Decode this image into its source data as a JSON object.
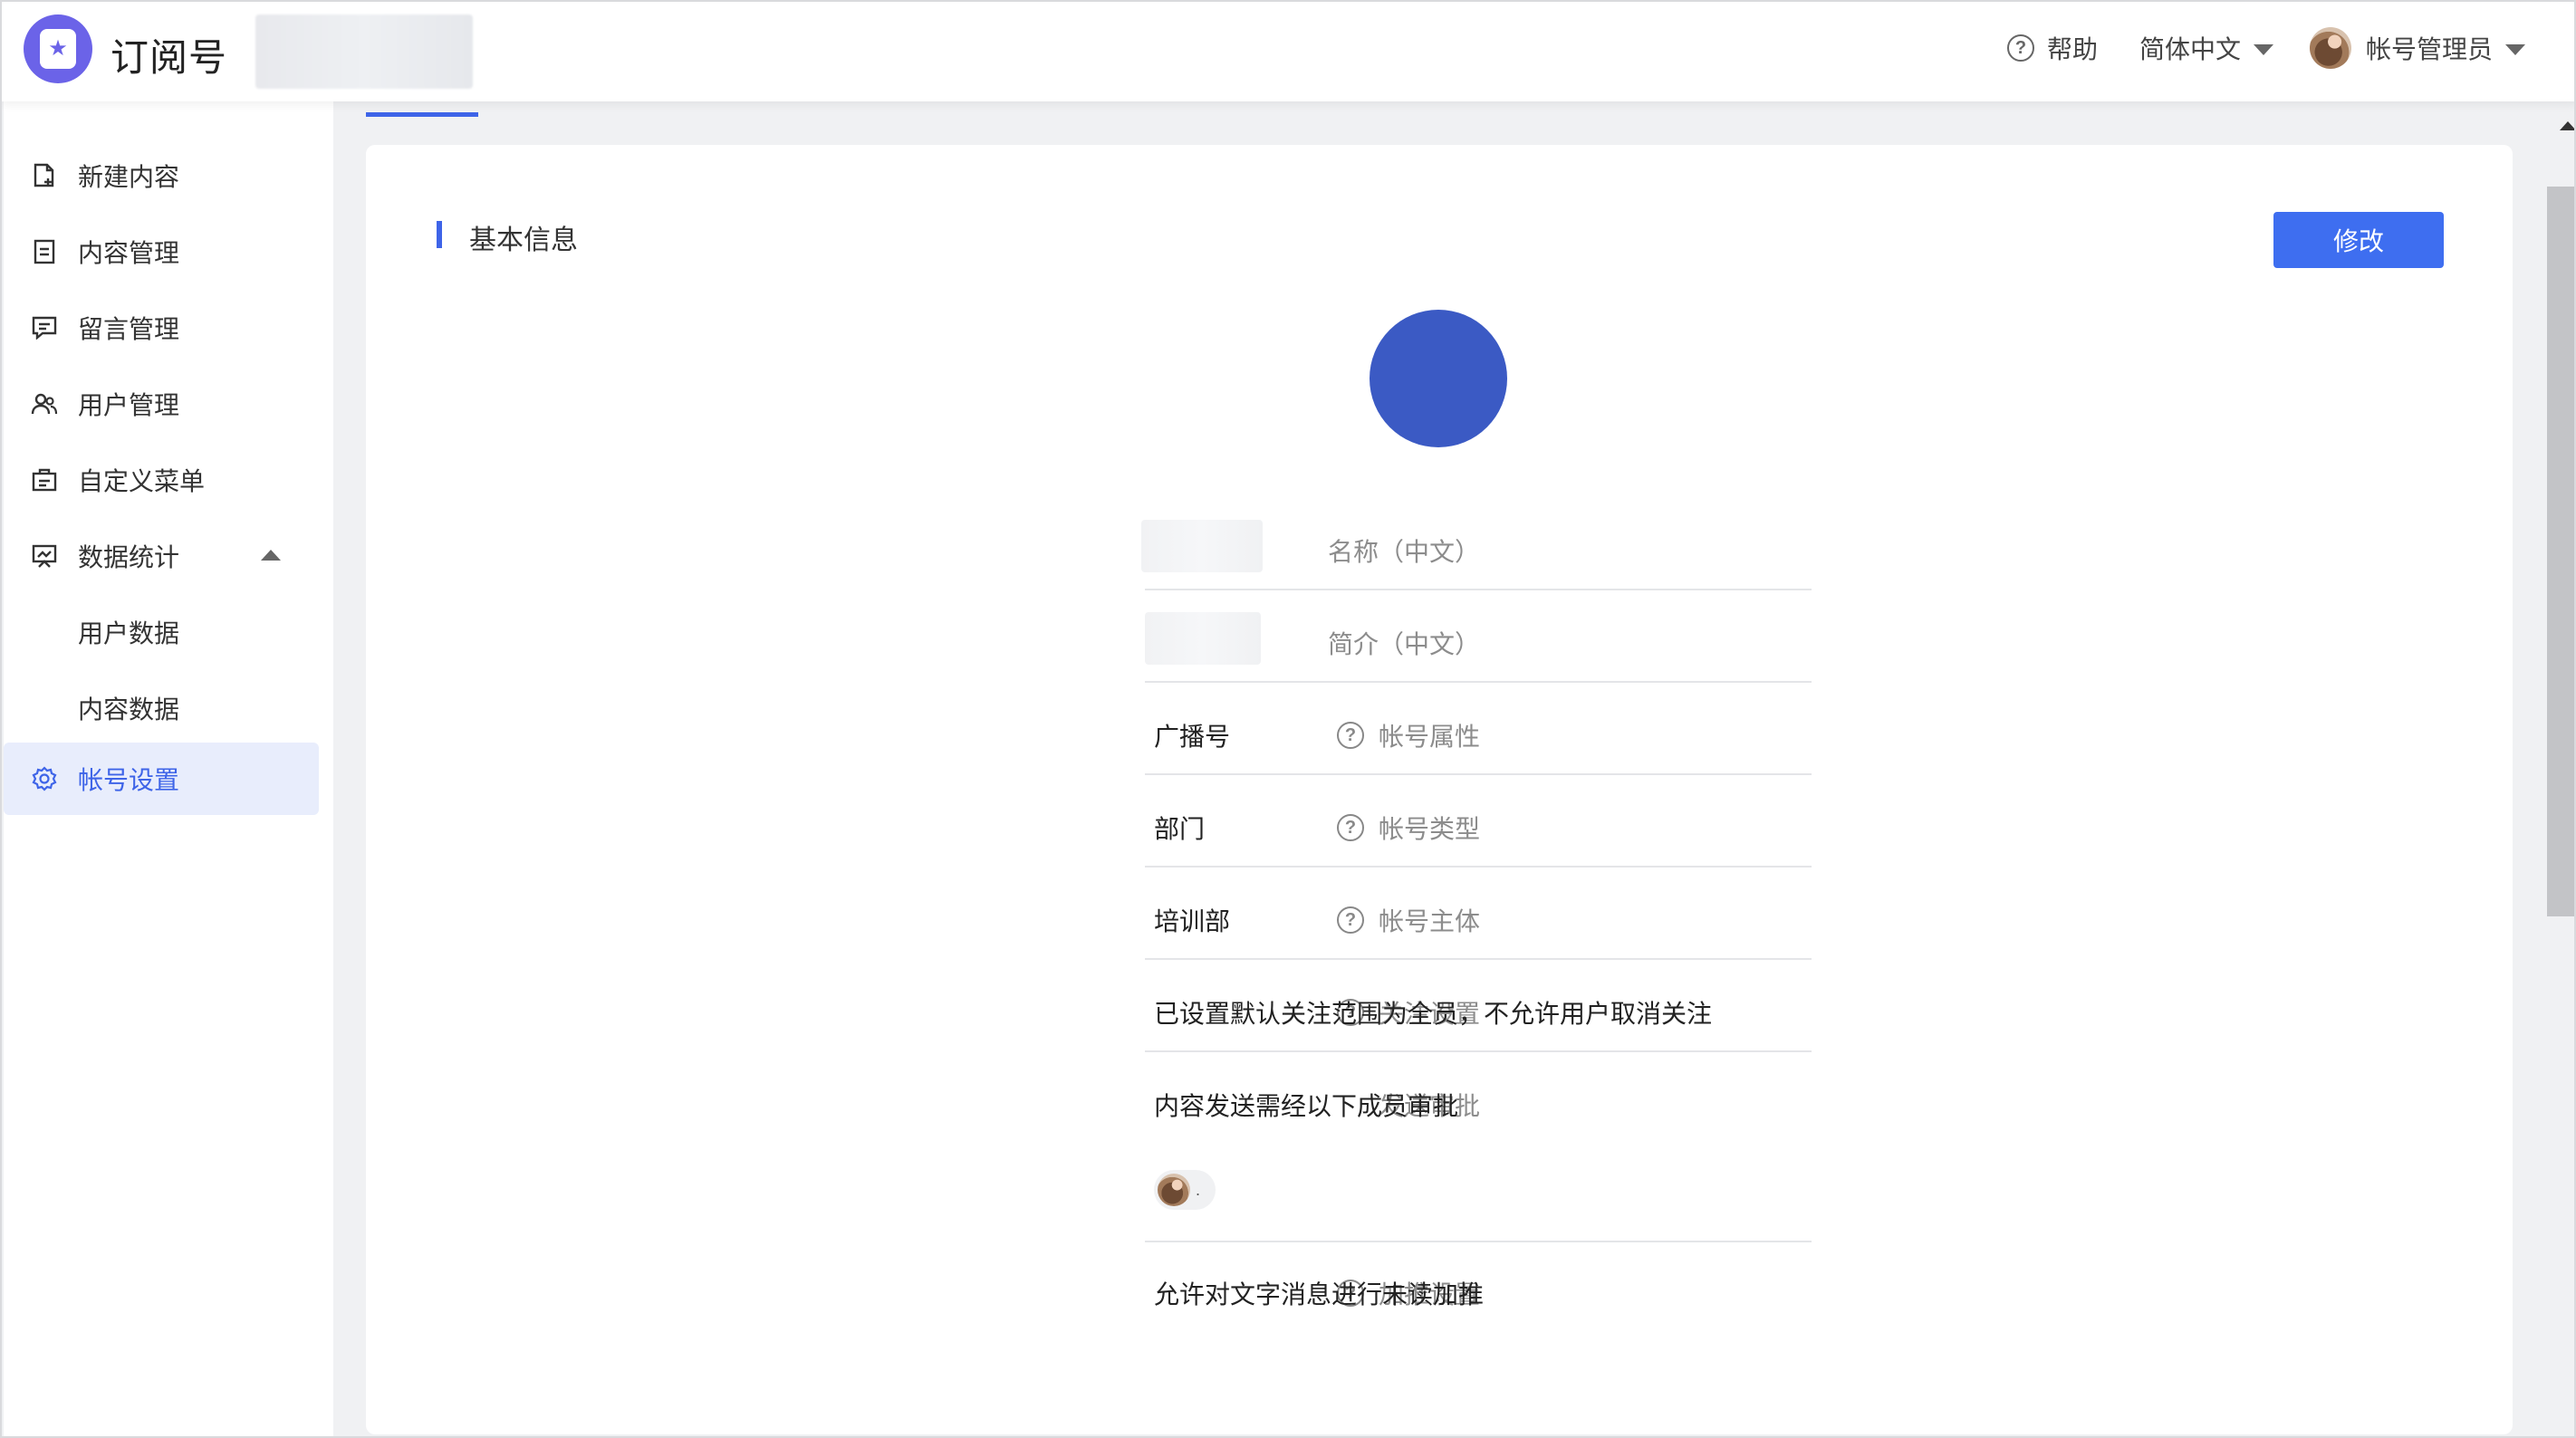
{
  "header": {
    "app_title": "订阅号",
    "help_label": "帮助",
    "language_label": "简体中文",
    "user_label": "帐号管理员"
  },
  "sidebar": {
    "items": [
      {
        "label": "新建内容",
        "icon": "new-document-icon"
      },
      {
        "label": "内容管理",
        "icon": "document-icon"
      },
      {
        "label": "留言管理",
        "icon": "comment-icon"
      },
      {
        "label": "用户管理",
        "icon": "users-icon"
      },
      {
        "label": "自定义菜单",
        "icon": "menu-icon"
      },
      {
        "label": "数据统计",
        "icon": "statistics-icon",
        "expanded": true
      },
      {
        "label": "用户数据",
        "sub": true
      },
      {
        "label": "内容数据",
        "sub": true
      },
      {
        "label": "帐号设置",
        "icon": "gear-icon",
        "active": true
      }
    ]
  },
  "main": {
    "section_title": "基本信息",
    "edit_button": "修改",
    "fields": [
      {
        "label": "名称（中文）",
        "value": "",
        "help": false
      },
      {
        "label": "简介（中文）",
        "value": "",
        "help": false
      },
      {
        "label": "帐号属性",
        "value": "广播号",
        "help": true
      },
      {
        "label": "帐号类型",
        "value": "部门",
        "help": true
      },
      {
        "label": "帐号主体",
        "value": "培训部",
        "help": true
      },
      {
        "label": "关注设置",
        "value": "已设置默认关注范围为全员，不允许用户取消关注",
        "help": true
      },
      {
        "label": "发送审批",
        "value": "内容发送需经以下成员审批",
        "help": false
      },
      {
        "label": "加推设置",
        "value": "允许对文字消息进行未读加推",
        "help": true
      }
    ],
    "approver_suffix": "."
  },
  "colors": {
    "accent": "#3e64e8",
    "button": "#3e6ef0",
    "avatar_circle": "#3b5ac4",
    "logo": "#6b63e8"
  }
}
